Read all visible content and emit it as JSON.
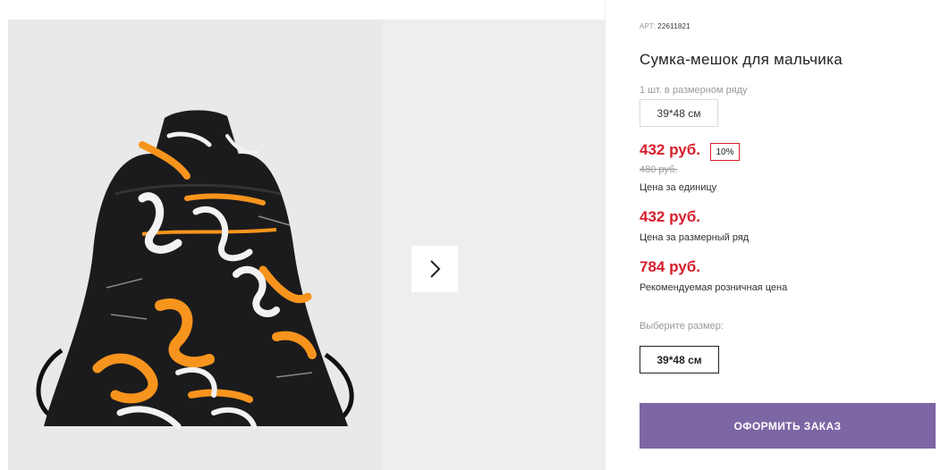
{
  "gallery": {
    "next_icon": "chevron-right-icon"
  },
  "product": {
    "sku_label": "АРТ:",
    "sku_value": "22611821",
    "title": "Сумка-мешок для мальчика",
    "in_row_label": "1 шт. в размерном ряду",
    "size_in_row": "39*48 см",
    "price_unit": "432 руб.",
    "discount": "10%",
    "old_price": "480 руб.",
    "price_unit_caption": "Цена за единицу",
    "price_row": "432 руб.",
    "price_row_caption": "Цена за размерный ряд",
    "price_retail": "784 руб.",
    "price_retail_caption": "Рекомендуемая розничная цена",
    "choose_size_label": "Выберите размер:",
    "selected_size": "39*48 см",
    "order_button": "ОФОРМИТЬ ЗАКАЗ"
  },
  "colors": {
    "price_red": "#d81e2c",
    "order_button": "#7c66a4",
    "bag_orange": "#f7941d",
    "bag_black": "#1b1b1d"
  }
}
